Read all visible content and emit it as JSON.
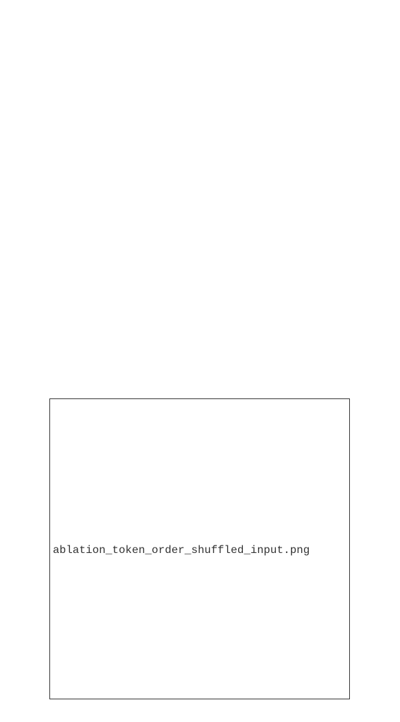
{
  "placeholder": {
    "filename": "ablation_token_order_shuffled_input.png"
  },
  "colors": {
    "background": "#ffffff",
    "border": "#333333",
    "text": "#333333"
  }
}
